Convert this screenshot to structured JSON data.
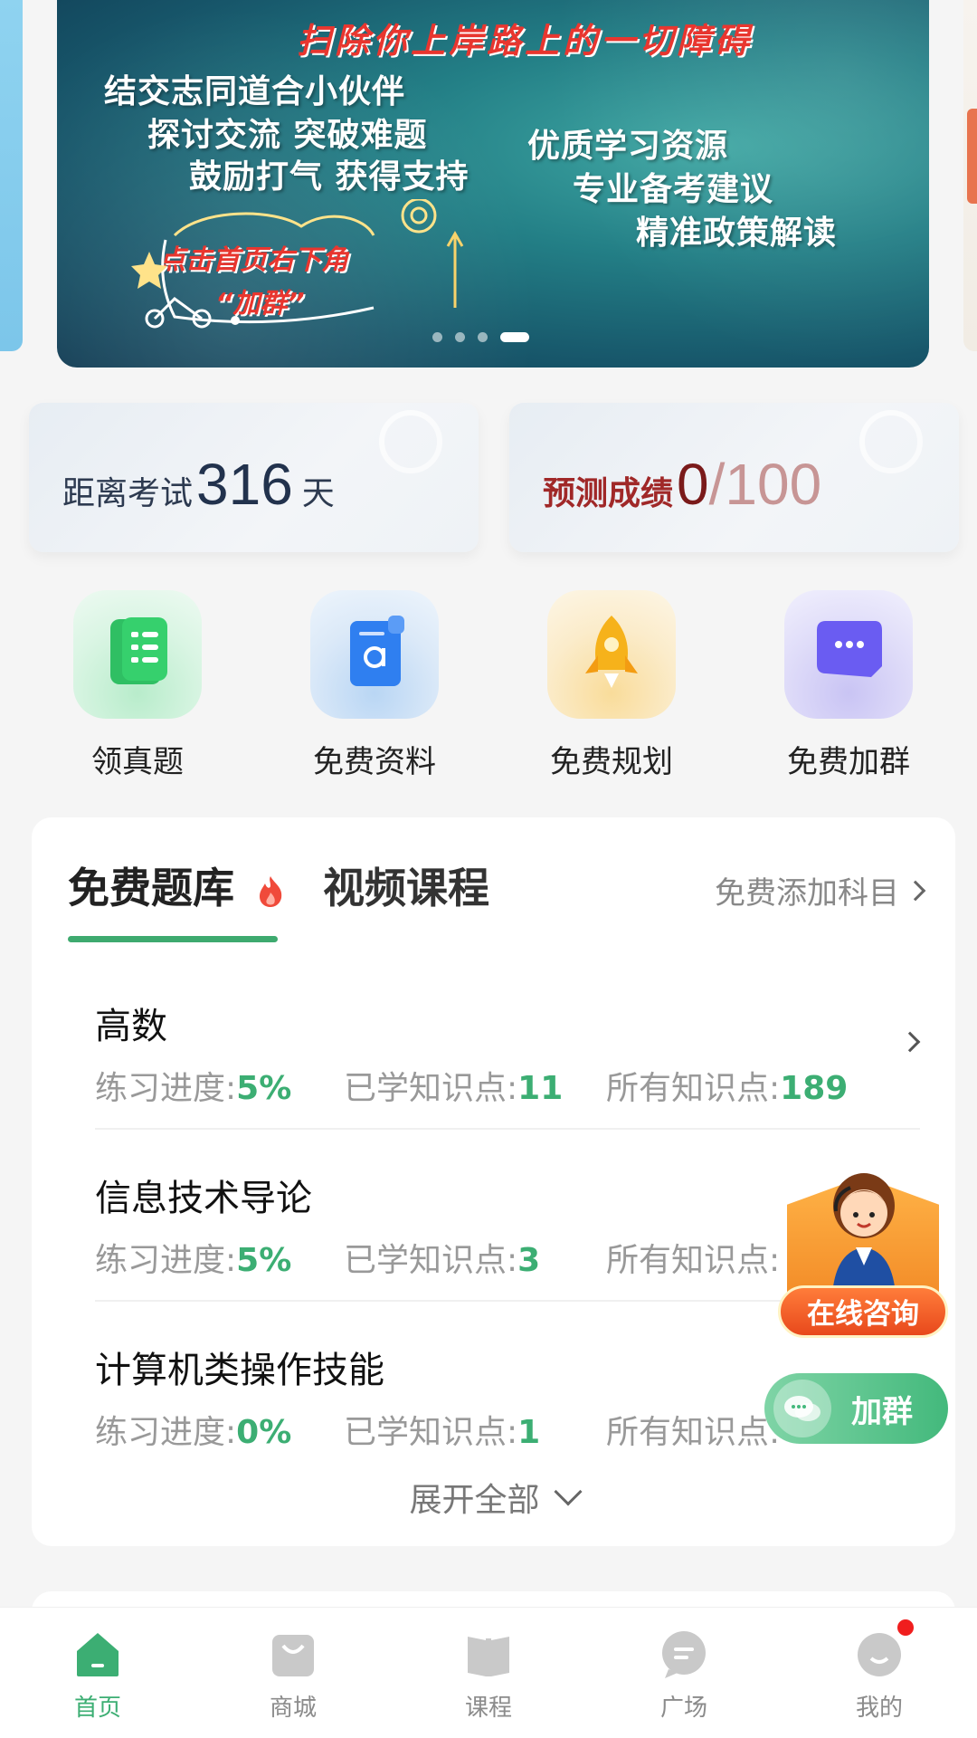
{
  "banner": {
    "headline": "扫除你上岸路上的一切障碍",
    "left_lines": [
      "结交志同道合小伙伴",
      "探讨交流 突破难题",
      "鼓励打气 获得支持"
    ],
    "right_lines": [
      "优质学习资源",
      "专业备考建议",
      "精准政策解读"
    ],
    "cta_line1": "点击首页右下角",
    "cta_line2": "“加群”",
    "dots_total": 4,
    "active_dot": 4
  },
  "stats": {
    "exam_label": "距离考试",
    "exam_days": "316",
    "exam_unit": "天",
    "predict_label": "预测成绩",
    "predict_score": "0",
    "predict_total": "/100"
  },
  "quick_actions": [
    {
      "label": "领真题",
      "icon": "exam-paper-icon"
    },
    {
      "label": "免费资料",
      "icon": "document-scroll-icon"
    },
    {
      "label": "免费规划",
      "icon": "rocket-icon"
    },
    {
      "label": "免费加群",
      "icon": "chat-bubble-icon"
    }
  ],
  "panel": {
    "tab_active": "免费题库",
    "tab_second": "视频课程",
    "add_subject": "免费添加科目",
    "progress_label": "练习进度:",
    "learned_label": "已学知识点:",
    "total_label": "所有知识点:",
    "courses": [
      {
        "title": "高数",
        "progress": "5%",
        "learned": "11",
        "total": "189"
      },
      {
        "title": "信息技术导论",
        "progress": "5%",
        "learned": "3",
        "total": ""
      },
      {
        "title": "计算机类操作技能",
        "progress": "0%",
        "learned": "1",
        "total": ""
      }
    ],
    "expand_all": "展开全部"
  },
  "float": {
    "consult_label": "在线咨询",
    "join_label": "加群"
  },
  "tabbar": {
    "items": [
      {
        "label": "首页",
        "icon": "home-icon",
        "active": true
      },
      {
        "label": "商城",
        "icon": "shopping-bag-icon",
        "active": false
      },
      {
        "label": "课程",
        "icon": "book-icon",
        "active": false
      },
      {
        "label": "广场",
        "icon": "chat-icon",
        "active": false
      },
      {
        "label": "我的",
        "icon": "profile-icon",
        "active": false
      }
    ]
  },
  "colors": {
    "accent_green": "#3cae73",
    "banner_red": "#e8362f",
    "badge_red": "#f01e1e"
  }
}
